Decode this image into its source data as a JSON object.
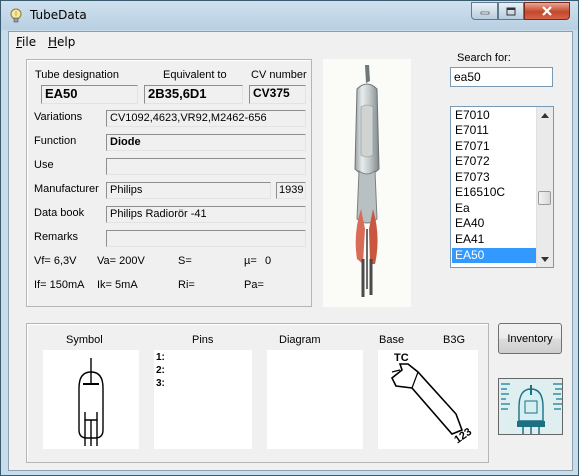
{
  "window": {
    "title": "TubeData"
  },
  "menu": {
    "file": "File",
    "help": "Help"
  },
  "details": {
    "tube_designation_label": "Tube designation",
    "tube_designation": "EA50",
    "equivalent_label": "Equivalent to",
    "equivalent": "2B35,6D1",
    "cv_label": "CV number",
    "cv": "CV375",
    "variations_label": "Variations",
    "variations": "CV1092,4623,VR92,M2462-656",
    "function_label": "Function",
    "function": "Diode",
    "use_label": "Use",
    "use": "",
    "manufacturer_label": "Manufacturer",
    "manufacturer": "Philips",
    "year": "1939",
    "databook_label": "Data book",
    "databook": "Philips Radiorör -41",
    "remarks_label": "Remarks",
    "remarks": ""
  },
  "ratings": {
    "vf": "Vf= 6,3V",
    "va": "Va= 200V",
    "s": "S=",
    "mu_label": "µ=",
    "mu": "0",
    "if": "If= 150mA",
    "ik": "Ik= 5mA",
    "ri": "Ri=",
    "pa": "Pa="
  },
  "search": {
    "label": "Search for:",
    "value": "ea50"
  },
  "tube_list": {
    "items": [
      "E7010",
      "E7011",
      "E7071",
      "E7072",
      "E7073",
      "E16510C",
      "Ea",
      "EA40",
      "EA41",
      "EA50"
    ],
    "selected": "EA50"
  },
  "bottom": {
    "symbol_label": "Symbol",
    "pins_label": "Pins",
    "diagram_label": "Diagram",
    "base_label": "Base",
    "base_value": "B3G",
    "pins": [
      "1:",
      "2:",
      "3:"
    ],
    "base_tc": "TC",
    "base_pin_numbers": "123"
  },
  "buttons": {
    "inventory": "Inventory"
  },
  "colors": {
    "selection": "#3399ff",
    "close_button": "#c3482b"
  }
}
